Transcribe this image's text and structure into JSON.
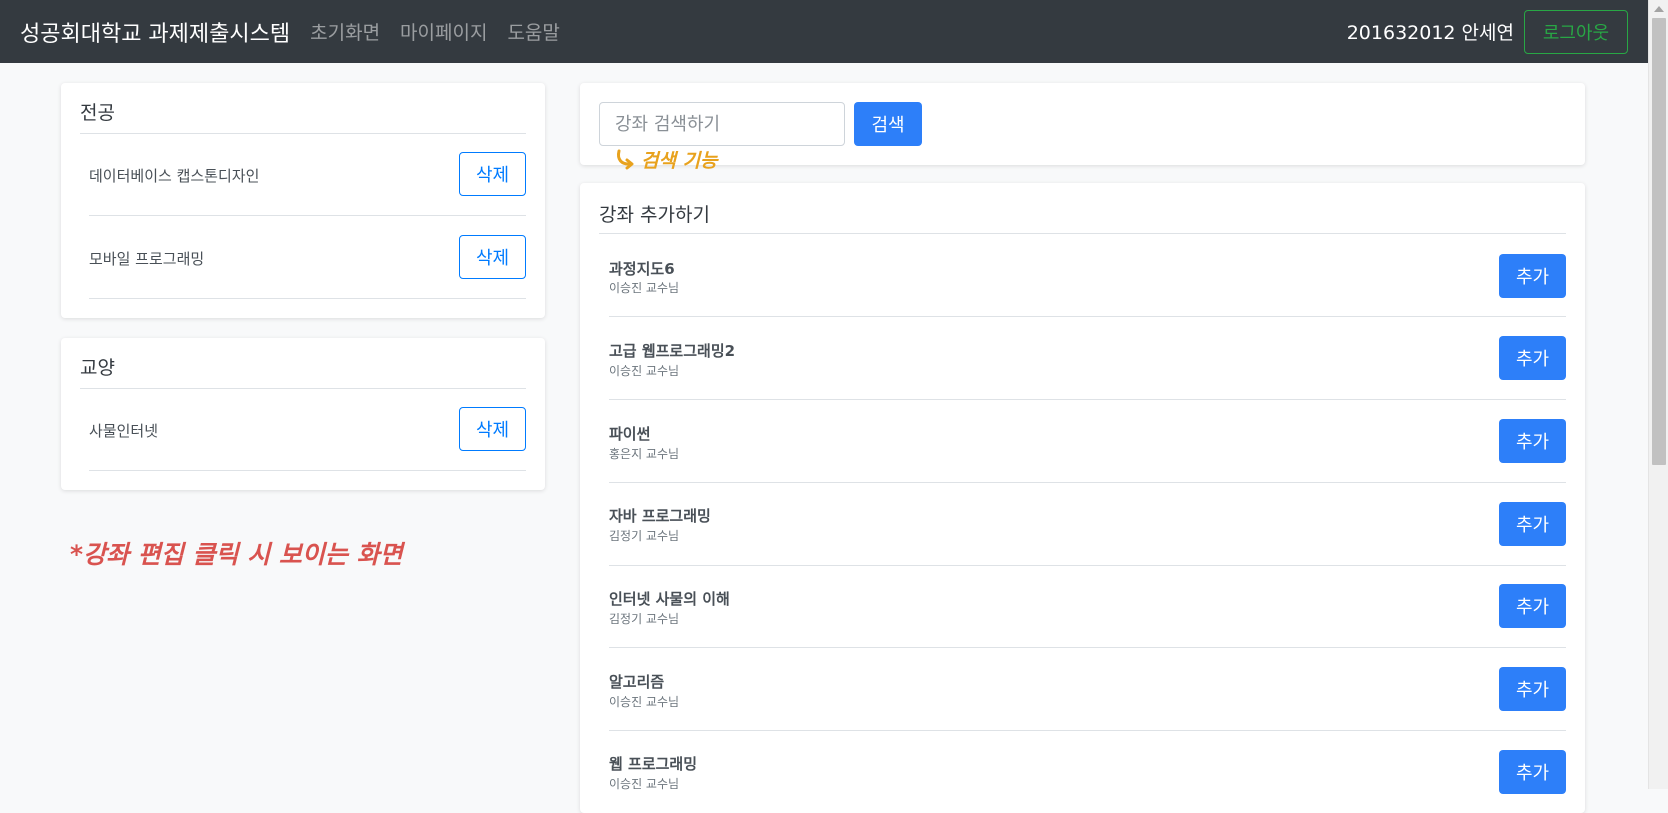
{
  "navbar": {
    "brand": "성공회대학교 과제제출시스템",
    "links": [
      "초기화면",
      "마이페이지",
      "도움말"
    ],
    "user": "201632012 안세연",
    "logout_label": "로그아웃"
  },
  "major_card": {
    "title": "전공",
    "courses": [
      {
        "name": "데이터베이스 캡스톤디자인",
        "action": "삭제"
      },
      {
        "name": "모바일 프로그래밍",
        "action": "삭제"
      }
    ]
  },
  "general_card": {
    "title": "교양",
    "courses": [
      {
        "name": "사물인터넷",
        "action": "삭제"
      }
    ]
  },
  "search": {
    "placeholder": "강좌 검색하기",
    "button_label": "검색"
  },
  "add_card": {
    "title": "강좌 추가하기",
    "courses": [
      {
        "name": "과정지도6",
        "professor": "이승진 교수님",
        "action": "추가"
      },
      {
        "name": "고급 웹프로그래밍2",
        "professor": "이승진 교수님",
        "action": "추가"
      },
      {
        "name": "파이썬",
        "professor": "홍은지 교수님",
        "action": "추가"
      },
      {
        "name": "자바 프로그래밍",
        "professor": "김정기 교수님",
        "action": "추가"
      },
      {
        "name": "인터넷 사물의 이해",
        "professor": "김정기 교수님",
        "action": "추가"
      },
      {
        "name": "알고리즘",
        "professor": "이승진 교수님",
        "action": "추가"
      },
      {
        "name": "웹 프로그래밍",
        "professor": "이승진 교수님",
        "action": "추가"
      }
    ]
  },
  "annotations": {
    "search_note": "검색 기능",
    "edit_note": "*강좌 편집 클릭 시 보이는 화면"
  },
  "colors": {
    "navbar_bg": "#343a40",
    "primary": "#2d7ff9",
    "outline_primary": "#007bff",
    "logout_green": "#28a745",
    "annotation_orange": "#e8a21d",
    "annotation_red": "#d9534f"
  }
}
